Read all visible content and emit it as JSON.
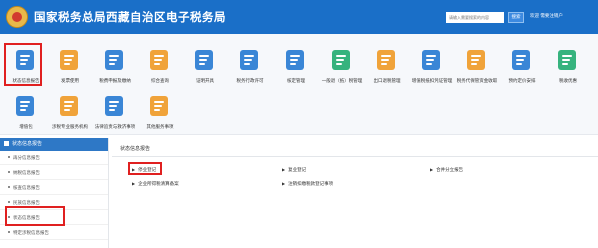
{
  "header": {
    "title": "国家税务总局西藏自治区电子税务局",
    "search_placeholder": "请输入需要搜索的内容",
    "search_button": "搜索",
    "user_text": "欢迎 需要注销户",
    "bg_color": "#1a6fc8"
  },
  "menu": {
    "row1": [
      {
        "label": "状态信息报告",
        "icon": "document-icon",
        "color": "#3a86d6"
      },
      {
        "label": "发票使用",
        "icon": "invoice-icon",
        "color": "#f0a33a"
      },
      {
        "label": "税费申报及缴纳",
        "icon": "tax-declare-icon",
        "color": "#3a86d6"
      },
      {
        "label": "综合查询",
        "icon": "query-icon",
        "color": "#f0a33a"
      },
      {
        "label": "证明开具",
        "icon": "certificate-icon",
        "color": "#3a86d6"
      },
      {
        "label": "税务行政许可",
        "icon": "permit-icon",
        "color": "#3a86d6"
      },
      {
        "label": "核定管理",
        "icon": "approval-icon",
        "color": "#3a86d6"
      },
      {
        "label": "一般退（抵）税管理",
        "icon": "refund-icon",
        "color": "#36b37e"
      },
      {
        "label": "出口退税管理",
        "icon": "export-refund-icon",
        "color": "#f0a33a"
      },
      {
        "label": "增值税抵扣凭证管理",
        "icon": "vat-voucher-icon",
        "color": "#3a86d6"
      },
      {
        "label": "税务代保管资金收取",
        "icon": "fund-icon",
        "color": "#f0a33a"
      },
      {
        "label": "预约定价安排",
        "icon": "pricing-icon",
        "color": "#3a86d6"
      },
      {
        "label": "税收优惠",
        "icon": "credit-icon",
        "color": "#36b37e"
      }
    ],
    "row2": [
      {
        "label": "增值包",
        "icon": "package-icon",
        "color": "#3a86d6"
      },
      {
        "label": "涉税专业服务机构",
        "icon": "agency-icon",
        "color": "#f0a33a"
      },
      {
        "label": "法律追责与救济事项",
        "icon": "legal-icon",
        "color": "#3a86d6"
      },
      {
        "label": "其他服务事项",
        "icon": "handshake-icon",
        "color": "#f0a33a"
      }
    ]
  },
  "sidebar": {
    "header": "状态信息报告",
    "items": [
      {
        "label": "再分信息报告"
      },
      {
        "label": "纳税信息报告"
      },
      {
        "label": "核查信息报告"
      },
      {
        "label": "民族信息报告"
      },
      {
        "label": "状态信息报告"
      },
      {
        "label": "特定涉税信息报告"
      }
    ]
  },
  "content": {
    "title": "状态信息报告",
    "links": [
      {
        "label": "停业登记"
      },
      {
        "label": "复业登记"
      },
      {
        "label": "合并分立报告"
      },
      {
        "label": "企业所得税清算备案"
      },
      {
        "label": "注销扣缴税款登记事项"
      }
    ]
  }
}
